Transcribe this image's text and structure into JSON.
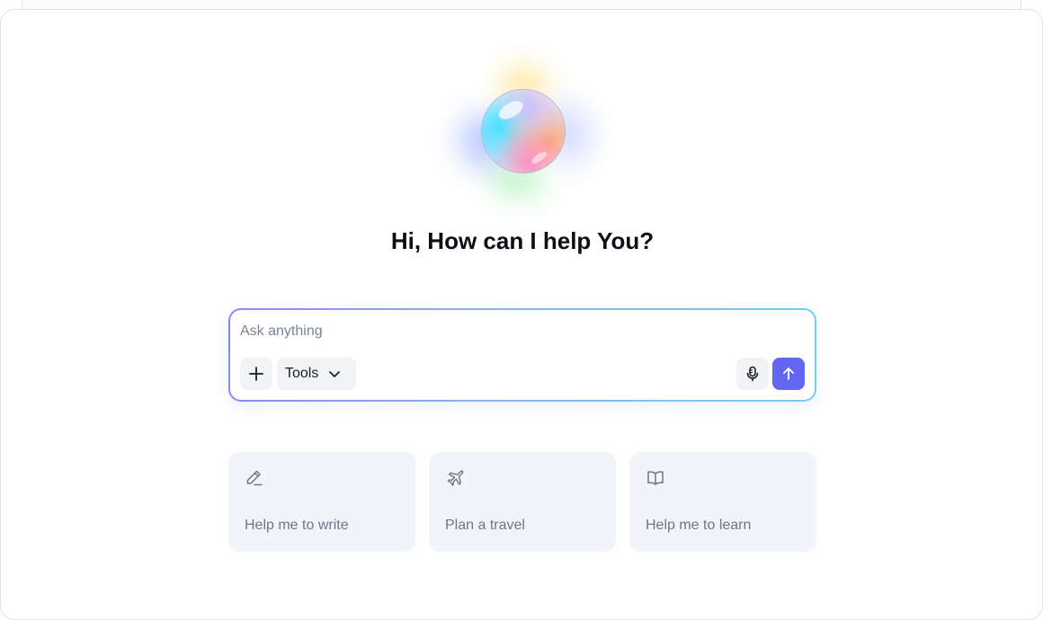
{
  "greeting": "Hi, How can I help You?",
  "composer": {
    "placeholder": "Ask anything",
    "value": "",
    "tools_label": "Tools",
    "icons": {
      "add": "plus-icon",
      "tools": "chevron-down-icon",
      "mic": "microphone-icon",
      "send": "arrow-up-icon"
    },
    "send_color": "#6366f1",
    "border_gradient": [
      "#8a86f4",
      "#8fb2f2",
      "#6ed0f2"
    ]
  },
  "suggestions": [
    {
      "label": "Help me to write",
      "icon": "pencil-icon"
    },
    {
      "label": "Plan a travel",
      "icon": "airplane-icon"
    },
    {
      "label": "Help me to learn",
      "icon": "book-open-icon"
    }
  ],
  "colors": {
    "card_background": "#f1f4f8",
    "muted_text": "#6b7789",
    "heading_text": "#0d0f14"
  }
}
